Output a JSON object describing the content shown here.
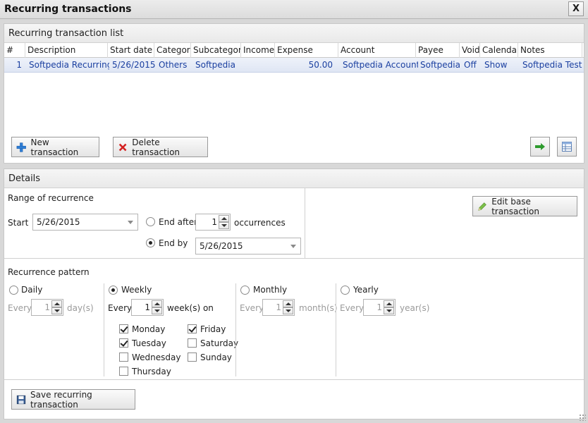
{
  "window": {
    "title": "Recurring transactions",
    "close_label": "X"
  },
  "list_panel": {
    "header": "Recurring transaction list",
    "columns": [
      "#",
      "Description",
      "Start date",
      "Category",
      "Subcategory",
      "Income",
      "Expense",
      "Account",
      "Payee",
      "Void",
      "Calendar",
      "Notes"
    ],
    "rows": [
      [
        "1",
        "Softpedia Recurring",
        "5/26/2015",
        "Others",
        "Softpedia",
        "",
        "50.00",
        "Softpedia Account",
        "Softpedia",
        "Off",
        "Show",
        "Softpedia Test"
      ]
    ],
    "new_button": "New transaction",
    "delete_button": "Delete transaction"
  },
  "details": {
    "header": "Details",
    "range_title": "Range of recurrence",
    "start_label": "Start",
    "start_value": "5/26/2015",
    "end_after_label": "End after",
    "end_after_value": "1",
    "occurrences_label": "occurrences",
    "end_by_label": "End by",
    "end_by_value": "5/26/2015",
    "end_mode": "end_by",
    "edit_base_button": "Edit base transaction",
    "pattern_title": "Recurrence pattern",
    "pattern_selected": "weekly",
    "daily": {
      "label": "Daily",
      "every": "Every",
      "value": "1",
      "unit": "day(s)"
    },
    "weekly": {
      "label": "Weekly",
      "every": "Every",
      "value": "1",
      "unit": "week(s) on",
      "days": [
        {
          "label": "Monday",
          "checked": true
        },
        {
          "label": "Tuesday",
          "checked": true
        },
        {
          "label": "Wednesday",
          "checked": false
        },
        {
          "label": "Thursday",
          "checked": false
        },
        {
          "label": "Friday",
          "checked": true
        },
        {
          "label": "Saturday",
          "checked": false
        },
        {
          "label": "Sunday",
          "checked": false
        }
      ]
    },
    "monthly": {
      "label": "Monthly",
      "every": "Every",
      "value": "1",
      "unit": "month(s)"
    },
    "yearly": {
      "label": "Yearly",
      "every": "Every",
      "value": "1",
      "unit": "year(s)"
    },
    "save_button": "Save recurring transaction"
  },
  "colors": {
    "row_text": "#1a3fa0",
    "add_icon": "#2f7fd6",
    "delete_icon": "#d42020",
    "arrow_icon": "#2e9b2e"
  }
}
